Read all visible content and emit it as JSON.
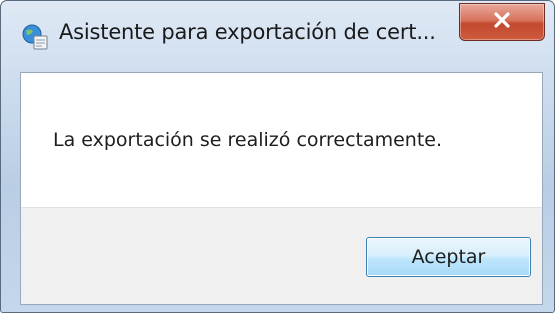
{
  "window": {
    "title": "Asistente para exportación de cert...",
    "app_icon": "certificate-wizard-icon",
    "close_icon": "close-x-icon"
  },
  "dialog": {
    "message": "La exportación se realizó correctamente.",
    "ok_label": "Aceptar"
  },
  "colors": {
    "close_button": "#c94b2f",
    "ok_button_border": "#3c7fb1",
    "footer_background": "#f0f0f0"
  }
}
